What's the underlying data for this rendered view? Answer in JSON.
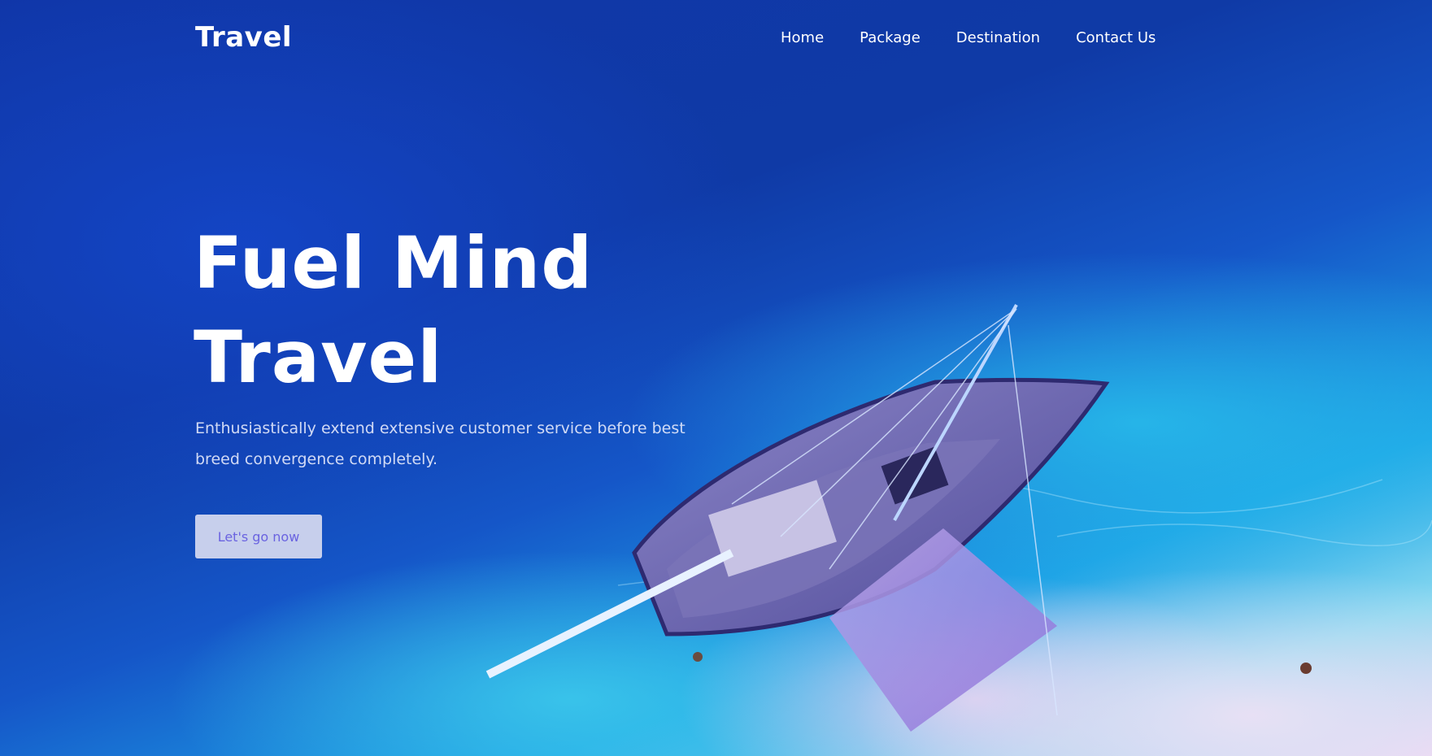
{
  "brand": {
    "logo_text": "Travel"
  },
  "nav": {
    "items": [
      {
        "label": "Home"
      },
      {
        "label": "Package"
      },
      {
        "label": "Destination"
      },
      {
        "label": "Contact Us"
      }
    ]
  },
  "hero": {
    "headline": "Fuel Mind Travel",
    "subtitle": "Enthusiastically extend extensive customer service before best breed convergence completely.",
    "cta_label": "Let's go now",
    "background_image": "aerial-boat-on-beach"
  },
  "colors": {
    "cta_text": "#6a63e0",
    "ocean_deep": "#0f3aa6",
    "shallow_water": "#1ea2e6",
    "sand": "#ead8f2"
  }
}
